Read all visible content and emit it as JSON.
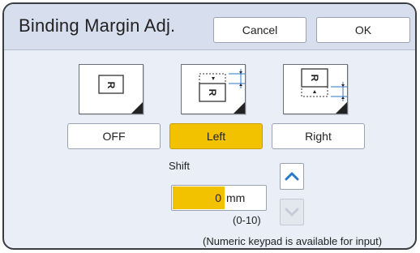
{
  "dialog": {
    "title": "Binding Margin Adj.",
    "cancel_label": "Cancel",
    "ok_label": "OK"
  },
  "modes": [
    {
      "label": "OFF",
      "selected": false,
      "icon": "binding-off-icon"
    },
    {
      "label": "Left",
      "selected": true,
      "icon": "binding-left-icon"
    },
    {
      "label": "Right",
      "selected": false,
      "icon": "binding-right-icon"
    }
  ],
  "shift": {
    "label": "Shift",
    "value": "0",
    "unit": "mm",
    "range": "(0-10)",
    "up_icon": "chevron-up-icon",
    "down_icon": "chevron-down-icon",
    "down_enabled": false
  },
  "note": "(Numeric keypad is available for input)",
  "colors": {
    "selected": "#f2c200",
    "title_bar": "#d7dfef",
    "background": "#e9eef7",
    "icon_blue": "#2a78c8"
  }
}
